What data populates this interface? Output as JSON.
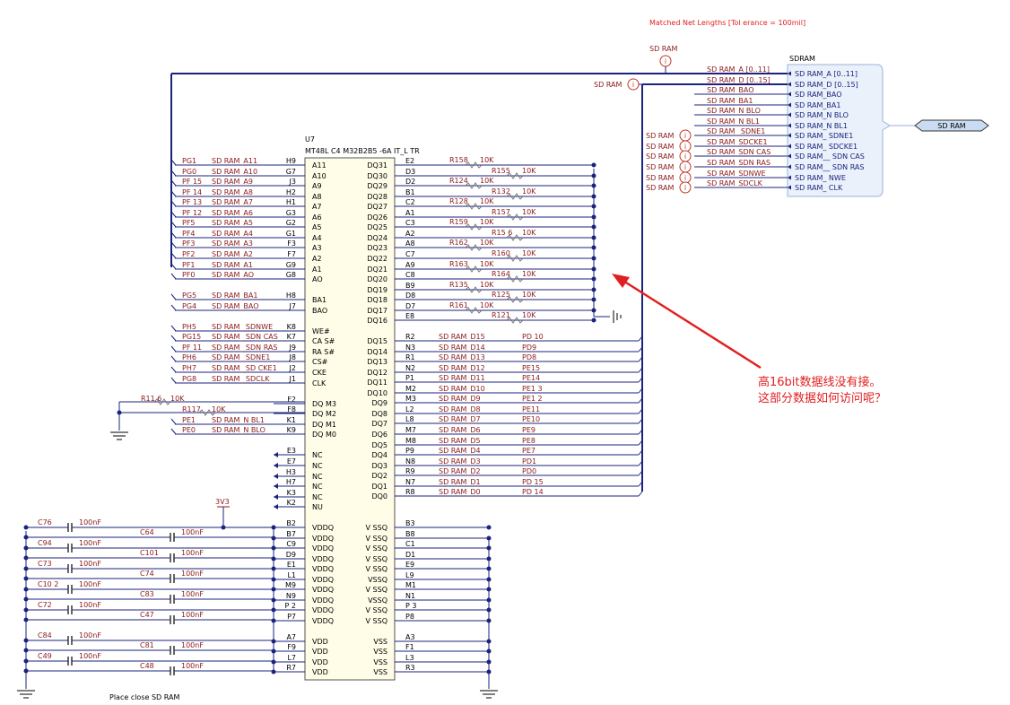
{
  "header_note": "Matched Net Lengths [Tol erance = 100mil]",
  "chip": {
    "ref": "U7",
    "part": "MT48L C4 M32B2B5 -6A  IT_L  TR",
    "left": [
      {
        "ext": "PG1",
        "net": "SD RAM_A11",
        "ball": "H9",
        "pin": "A11"
      },
      {
        "ext": "PG0",
        "net": "SD RAM_A10",
        "ball": "G7",
        "pin": "A10"
      },
      {
        "ext": "PF 15",
        "net": "SD RAM_A9",
        "ball": "J3",
        "pin": "A9"
      },
      {
        "ext": "PF 14",
        "net": "SD RAM_A8",
        "ball": "H2",
        "pin": "A8"
      },
      {
        "ext": "PF 13",
        "net": "SD RAM_A7",
        "ball": "H1",
        "pin": "A7"
      },
      {
        "ext": "PF 12",
        "net": "SD RAM_A6",
        "ball": "G3",
        "pin": "A6"
      },
      {
        "ext": "PF5",
        "net": "SD RAM_A5",
        "ball": "G2",
        "pin": "A5"
      },
      {
        "ext": "PF4",
        "net": "SD RAM_A4",
        "ball": "G1",
        "pin": "A4"
      },
      {
        "ext": "PF3",
        "net": "SD RAM_A3",
        "ball": "F3",
        "pin": "A3"
      },
      {
        "ext": "PF2",
        "net": "SD RAM_A2",
        "ball": "F7",
        "pin": "A2"
      },
      {
        "ext": "PF1",
        "net": "SD RAM_A1",
        "ball": "G9",
        "pin": "A1"
      },
      {
        "ext": "PF0",
        "net": "SD RAM_AO",
        "ball": "G8",
        "pin": "AO"
      },
      {
        "ext": "",
        "net": "",
        "ball": "",
        "pin": ""
      },
      {
        "ext": "PG5",
        "net": "SD RAM_BA1",
        "ball": "H8",
        "pin": "BA1"
      },
      {
        "ext": "PG4",
        "net": "SD RAM_BAO",
        "ball": "J7",
        "pin": "BAO"
      },
      {
        "ext": "",
        "net": "",
        "ball": "",
        "pin": ""
      },
      {
        "ext": "PH5",
        "net": "SD RAM_ SDNWE",
        "ball": "K8",
        "pin": "WE#"
      },
      {
        "ext": "PG15",
        "net": "SD RAM_ SDN CAS",
        "ball": "K7",
        "pin": "CA S#"
      },
      {
        "ext": "PF 11",
        "net": "SD RAM_ SDN RAS",
        "ball": "J9",
        "pin": "RA S#"
      },
      {
        "ext": "PH6",
        "net": "SD RAM_ SDNE1",
        "ball": "J8",
        "pin": "CS#"
      },
      {
        "ext": "PH7",
        "net": "SD RAM_ SD CKE1",
        "ball": "J2",
        "pin": "CKE"
      },
      {
        "ext": "PG8",
        "net": "SD RAM_ SDCLK",
        "ball": "J1",
        "pin": "CLK"
      },
      {
        "ext": "",
        "net": "",
        "ball": "",
        "pin": ""
      },
      {
        "ext": "",
        "net": "",
        "ball": "F2",
        "pin": "DQ M3"
      },
      {
        "ext": "",
        "net": "",
        "ball": "F8",
        "pin": "DQ M2"
      },
      {
        "ext": "PE1",
        "net": "SD RAM_N BL1",
        "ball": "K1",
        "pin": "DQ M1"
      },
      {
        "ext": "PE0",
        "net": "SD RAM_N BLO",
        "ball": "K9",
        "pin": "DQ M0"
      },
      {
        "ext": "",
        "net": "",
        "ball": "",
        "pin": ""
      },
      {
        "ext": "",
        "net": "",
        "ball": "E3",
        "pin": "NC"
      },
      {
        "ext": "",
        "net": "",
        "ball": "E7",
        "pin": "NC"
      },
      {
        "ext": "",
        "net": "",
        "ball": "H3",
        "pin": "NC"
      },
      {
        "ext": "",
        "net": "",
        "ball": "H7",
        "pin": "NC"
      },
      {
        "ext": "",
        "net": "",
        "ball": "K3",
        "pin": "NC"
      },
      {
        "ext": "",
        "net": "",
        "ball": "K2",
        "pin": "NU"
      }
    ],
    "right_upper": [
      {
        "pin": "DQ31",
        "ball": "E2",
        "res": "R158",
        "val": "10K"
      },
      {
        "pin": "DQ30",
        "ball": "D3",
        "res": "R155",
        "val": "10K"
      },
      {
        "pin": "DQ29",
        "ball": "D2",
        "res": "R124",
        "val": "10K"
      },
      {
        "pin": "DQ28",
        "ball": "B1",
        "res": "R132",
        "val": "10K"
      },
      {
        "pin": "DQ27",
        "ball": "C2",
        "res": "R128",
        "val": "10K"
      },
      {
        "pin": "DQ26",
        "ball": "A1",
        "res": "R157",
        "val": "10K"
      },
      {
        "pin": "DQ25",
        "ball": "C3",
        "res": "R159",
        "val": "10K"
      },
      {
        "pin": "DQ24",
        "ball": "A2",
        "res": "R15 6",
        "val": "10K"
      },
      {
        "pin": "DQ23",
        "ball": "A8",
        "res": "R162",
        "val": "10K"
      },
      {
        "pin": "DQ22",
        "ball": "C7",
        "res": "R160",
        "val": "10K"
      },
      {
        "pin": "DQ21",
        "ball": "A9",
        "res": "R163",
        "val": "10K"
      },
      {
        "pin": "DQ20",
        "ball": "C8",
        "res": "R164",
        "val": "10K"
      },
      {
        "pin": "DQ19",
        "ball": "B9",
        "res": "R135",
        "val": "10K"
      },
      {
        "pin": "DQ18",
        "ball": "D8",
        "res": "R125",
        "val": "10K"
      },
      {
        "pin": "DQ17",
        "ball": "D7",
        "res": "R161",
        "val": "10K"
      },
      {
        "pin": "DQ16",
        "ball": "E8",
        "res": "R121",
        "val": "10K"
      }
    ],
    "right_lower": [
      {
        "pin": "DQ15",
        "ball": "R2",
        "net": "SD RAM_D15",
        "ext": "PD 10"
      },
      {
        "pin": "DQ14",
        "ball": "N3",
        "net": "SD RAM_D14",
        "ext": "PD9"
      },
      {
        "pin": "DQ13",
        "ball": "R1",
        "net": "SD RAM_D13",
        "ext": "PD8"
      },
      {
        "pin": "DQ12",
        "ball": "N2",
        "net": "SD RAM_D12",
        "ext": "PE15"
      },
      {
        "pin": "DQ11",
        "ball": "P1",
        "net": "SD RAM_D11",
        "ext": "PE14"
      },
      {
        "pin": "DQ10",
        "ball": "M2",
        "net": "SD RAM_D10",
        "ext": "PE1 3"
      },
      {
        "pin": "DQ9",
        "ball": "M3",
        "net": "SD RAM_D9",
        "ext": "PE1 2"
      },
      {
        "pin": "DQ8",
        "ball": "L2",
        "net": "SD RAM_D8",
        "ext": "PE11"
      },
      {
        "pin": "DQ7",
        "ball": "L8",
        "net": "SD RAM_D7",
        "ext": "PE10"
      },
      {
        "pin": "DQ6",
        "ball": "M7",
        "net": "SD RAM_D6",
        "ext": "PE9"
      },
      {
        "pin": "DQ5",
        "ball": "M8",
        "net": "SD RAM_D5",
        "ext": "PE8"
      },
      {
        "pin": "DQ4",
        "ball": "P9",
        "net": "SD RAM_D4",
        "ext": "PE7"
      },
      {
        "pin": "DQ3",
        "ball": "N8",
        "net": "SD RAM_D3",
        "ext": "PD1"
      },
      {
        "pin": "DQ2",
        "ball": "R9",
        "net": "SD RAM_D2",
        "ext": "PD0"
      },
      {
        "pin": "DQ1",
        "ball": "N7",
        "net": "SD RAM_D1",
        "ext": "PD 15"
      },
      {
        "pin": "DQ0",
        "ball": "R8",
        "net": "SD RAM_D0",
        "ext": "PD 14"
      }
    ],
    "power_left": [
      {
        "pin": "VDDQ",
        "ball": "B2"
      },
      {
        "pin": "VDDQ",
        "ball": "B7"
      },
      {
        "pin": "VDDQ",
        "ball": "C9"
      },
      {
        "pin": "VDDQ",
        "ball": "D9"
      },
      {
        "pin": "VDDQ",
        "ball": "E1"
      },
      {
        "pin": "VDDQ",
        "ball": "L1"
      },
      {
        "pin": "VDDQ",
        "ball": "M9"
      },
      {
        "pin": "VDDQ",
        "ball": "N9"
      },
      {
        "pin": "VDDQ",
        "ball": "P 2"
      },
      {
        "pin": "VDDQ",
        "ball": "P7"
      },
      {
        "pin": "",
        "ball": ""
      },
      {
        "pin": "VDD",
        "ball": "A7"
      },
      {
        "pin": "VDD",
        "ball": "F9"
      },
      {
        "pin": "VDD",
        "ball": "L7"
      },
      {
        "pin": "VDD",
        "ball": "R7"
      }
    ],
    "power_right": [
      {
        "pin": "V SSQ",
        "ball": "B3"
      },
      {
        "pin": "V SSQ",
        "ball": "B8"
      },
      {
        "pin": "V SSQ",
        "ball": "C1"
      },
      {
        "pin": "V SSQ",
        "ball": "D1"
      },
      {
        "pin": "V SSQ",
        "ball": "E9"
      },
      {
        "pin": "VSSQ",
        "ball": "L9"
      },
      {
        "pin": "V SSQ",
        "ball": "M1"
      },
      {
        "pin": "VSSQ",
        "ball": "N1"
      },
      {
        "pin": "V SSQ",
        "ball": "P 3"
      },
      {
        "pin": "V SSQ",
        "ball": "P8"
      },
      {
        "pin": "",
        "ball": ""
      },
      {
        "pin": "VSS",
        "ball": "A3"
      },
      {
        "pin": "VSS",
        "ball": "F1"
      },
      {
        "pin": "VSS",
        "ball": "L3"
      },
      {
        "pin": "VSS",
        "ball": "R3"
      }
    ]
  },
  "dqm_resistors": [
    {
      "ref": "R11 6",
      "val": "10K"
    },
    {
      "ref": "R117",
      "val": "10K"
    }
  ],
  "supply_label": "3V3",
  "caps_left": [
    {
      "ref": "C76",
      "val": "100nF"
    },
    {
      "ref": "C94",
      "val": "100nF"
    },
    {
      "ref": "C73",
      "val": "100nF"
    },
    {
      "ref": "C10 2",
      "val": "100nF"
    },
    {
      "ref": "C72",
      "val": "100nF"
    },
    {
      "ref": "C84",
      "val": "100nF"
    },
    {
      "ref": "C49",
      "val": "100nF"
    }
  ],
  "caps_right": [
    {
      "ref": "C64",
      "val": "100nF"
    },
    {
      "ref": "C101",
      "val": "100nF"
    },
    {
      "ref": "C74",
      "val": "100nF"
    },
    {
      "ref": "C83",
      "val": "100nF"
    },
    {
      "ref": "C47",
      "val": "100nF"
    },
    {
      "ref": "C81",
      "val": "100nF"
    },
    {
      "ref": "C48",
      "val": "100nF"
    }
  ],
  "place_note": "Place close SD RAM",
  "harness": {
    "title": "SDRAM",
    "port_label": "SD RAM",
    "rows": [
      {
        "left": "SD RAM_A  [0..11]",
        "right": "SD RAM_A  [0..11]",
        "flag": ""
      },
      {
        "left": "SD RAM_D  [0..15]",
        "right": "SD RAM_D  [0..15]",
        "flag": ""
      },
      {
        "left": "SD RAM_BAO",
        "right": "SD RAM_BAO",
        "flag": ""
      },
      {
        "left": "SD RAM_BA1",
        "right": "SD RAM_BA1",
        "flag": ""
      },
      {
        "left": "SD RAM_N  BLO",
        "right": "SD RAM_N  BLO",
        "flag": ""
      },
      {
        "left": "SD RAM_N  BL1",
        "right": "SD RAM_N  BL1",
        "flag": ""
      },
      {
        "left": "SD RAM_ SDNE1",
        "right": "SD RAM_ SDNE1",
        "flag": "SD RAM"
      },
      {
        "left": "SD RAM_SDCKE1",
        "right": "SD RAM_ SDCKE1",
        "flag": "SD RAM"
      },
      {
        "left": "SD RAM_SDN CAS",
        "right": "SD RAM__ SDN CAS",
        "flag": "SD RAM"
      },
      {
        "left": "SD RAM_SDN RAS",
        "right": "SD RAM__ SDN RAS",
        "flag": "SD RAM"
      },
      {
        "left": "SD RAM_SDNWE",
        "right": "SD RAM_ NWE",
        "flag": "SD RAM"
      },
      {
        "left": "SD RAM_SDCLK",
        "right": "SD RAM_ CLK",
        "flag": "SD RAM"
      }
    ],
    "flag_top": "SD RAM",
    "flag_d": "SD RAM"
  },
  "annotation": {
    "line1": "高16bit数据线没有接。",
    "line2": "这部分数据如何访问呢？"
  },
  "colors": {
    "wire": "#1a237e",
    "label": "#8b1a1a",
    "annotation": "#e02020",
    "harness_fill": "#eaf1fb",
    "harness_stroke": "#9bb3d6"
  }
}
